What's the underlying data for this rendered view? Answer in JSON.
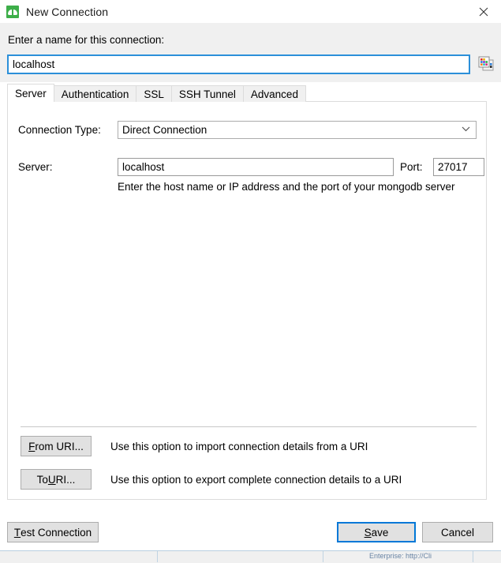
{
  "window": {
    "title": "New Connection",
    "icon": "mongodb-leaf-icon",
    "close_label": "✕",
    "accent_focus_color": "#0078d7",
    "brand_color": "#3dae49"
  },
  "header": {
    "name_label": "Enter a name for this connection:",
    "name_value": "localhost",
    "name_placeholder": "",
    "palette_icon": "color-palette-icon"
  },
  "tabs": [
    {
      "label": "Server",
      "selected": true
    },
    {
      "label": "Authentication",
      "selected": false
    },
    {
      "label": "SSL",
      "selected": false
    },
    {
      "label": "SSH Tunnel",
      "selected": false
    },
    {
      "label": "Advanced",
      "selected": false
    }
  ],
  "server_tab": {
    "connection_type_label": "Connection Type:",
    "connection_type_value": "Direct Connection",
    "connection_type_options": [
      "Direct Connection"
    ],
    "chevron_icon": "chevron-down-icon",
    "server_label": "Server:",
    "server_value": "localhost",
    "port_label": "Port:",
    "port_value": "27017",
    "hint": "Enter the host name or IP address and the port of your mongodb server",
    "from_uri_button": {
      "prefix": "",
      "mnemonic": "F",
      "suffix": "rom URI..."
    },
    "from_uri_desc": "Use this option to import connection details from a URI",
    "to_uri_button": {
      "prefix": "To ",
      "mnemonic": "U",
      "suffix": "RI..."
    },
    "to_uri_desc": "Use this option to export complete connection details to a URI"
  },
  "footer": {
    "test_connection": {
      "prefix": "",
      "mnemonic": "T",
      "suffix": "est Connection"
    },
    "save": {
      "prefix": "",
      "mnemonic": "S",
      "suffix": "ave"
    },
    "cancel": {
      "prefix": "",
      "mnemonic": "",
      "suffix": "Cancel"
    }
  },
  "background_window": {
    "status_text": "Enterprise: http://Cli"
  }
}
